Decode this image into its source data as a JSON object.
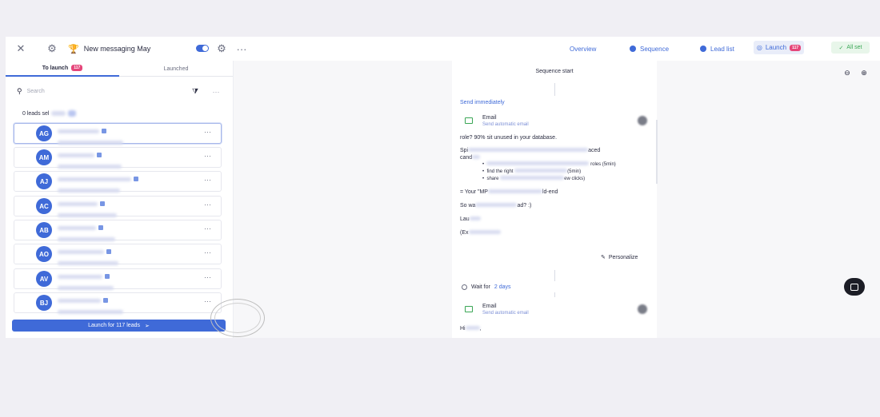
{
  "header": {
    "campaign_title": "New messaging May",
    "nav": {
      "overview": "Overview",
      "sequence": "Sequence",
      "lead_list": "Lead list",
      "launch": "Launch",
      "launch_badge": "117",
      "all_set": "All set"
    }
  },
  "left_panel": {
    "tabs": {
      "to_launch": "To launch",
      "to_launch_badge": "117",
      "launched": "Launched"
    },
    "search_placeholder": "Search",
    "selected_text": "0 leads sel",
    "leads": [
      {
        "initials": "AG"
      },
      {
        "initials": "AM"
      },
      {
        "initials": "AJ"
      },
      {
        "initials": "AC"
      },
      {
        "initials": "AB"
      },
      {
        "initials": "AO"
      },
      {
        "initials": "AV"
      },
      {
        "initials": "BJ"
      }
    ],
    "launch_button": "Launch for 117 leads"
  },
  "sequence": {
    "start_label": "Sequence start",
    "step1_label": "Send immediately",
    "email1": {
      "title": "Email",
      "subtitle": "Send automatic email"
    },
    "body_lines": {
      "l1": "role? 90% sit unused in your database.",
      "l2": "Spi",
      "l2b": "aced",
      "l3": "cand",
      "b1": "roles (5min)",
      "b2": "find the right",
      "b2b": "(5min)",
      "b3": "share",
      "b3b": "ew clicks)",
      "l4": "= Your \"MP",
      "l4b": "ld-end",
      "l5": "So wa",
      "l5b": "ad? :)",
      "l6": "Lau",
      "l7": "(Ex"
    },
    "personalize": "Personalize",
    "wait_prefix": "Wait for",
    "wait_value": "2 days",
    "email2": {
      "title": "Email",
      "subtitle": "Send automatic email"
    },
    "email2_greeting": "Hi"
  }
}
